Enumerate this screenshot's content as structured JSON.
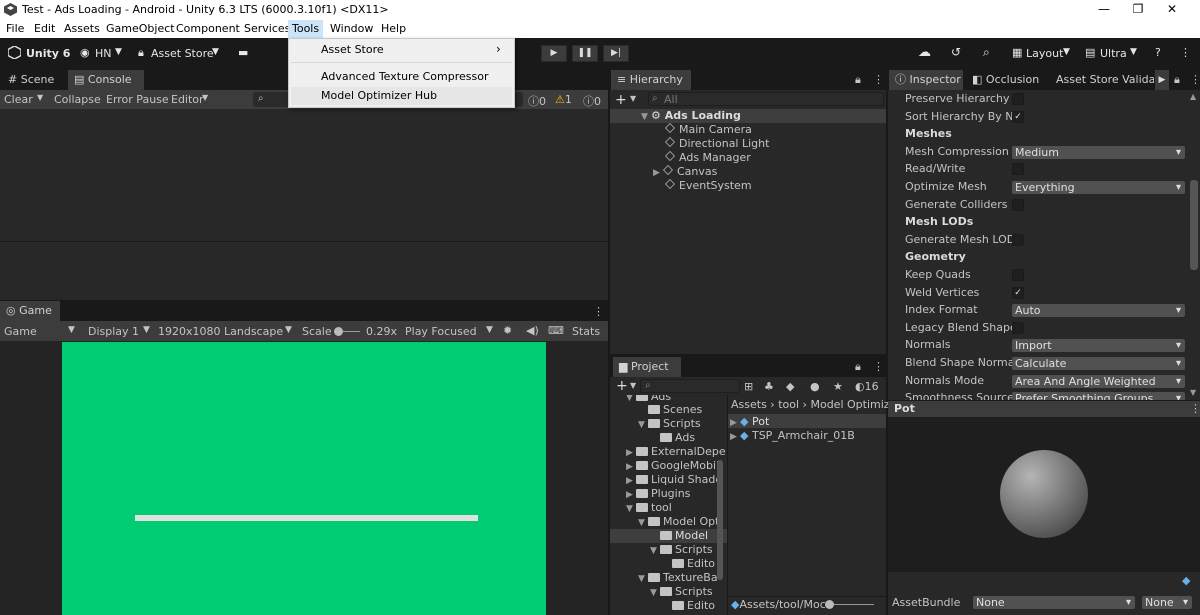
{
  "window": {
    "title": "Test - Ads Loading - Android - Unity 6.3 LTS (6000.3.10f1) <DX11>",
    "min": "—",
    "max": "❐",
    "close": "✕"
  },
  "menubar": [
    "File",
    "Edit",
    "Assets",
    "GameObject",
    "Component",
    "Services",
    "Tools",
    "Window",
    "Help"
  ],
  "toolbar": {
    "unity": "Unity 6",
    "account": "HN",
    "asset_store": "Asset Store",
    "layout": "Layout",
    "quality": "Ultra"
  },
  "tools_menu": {
    "items": [
      "Asset Store",
      "Advanced Texture Compressor",
      "Model Optimizer Hub"
    ],
    "submenu_arrow": "›"
  },
  "scene_tabs": {
    "scene": "Scene",
    "console": "Console"
  },
  "console": {
    "clear": "Clear",
    "collapse": "Collapse",
    "error_pause": "Error Pause",
    "editor": "Editor",
    "log_count": "0",
    "warn_count": "1",
    "error_count": "0"
  },
  "game": {
    "tab": "Game",
    "mode": "Game",
    "display": "Display 1",
    "resolution": "1920x1080 Landscape",
    "scale_label": "Scale",
    "scale_value": "0.29x",
    "play_focused": "Play Focused",
    "stats": "Stats",
    "bg_color": "#00cc74",
    "progress": 1.0
  },
  "hierarchy": {
    "tab": "Hierarchy",
    "search": "All",
    "scene": "Ads Loading",
    "items": [
      "Main Camera",
      "Directional Light",
      "Ads Manager",
      "Canvas",
      "EventSystem"
    ]
  },
  "project": {
    "tab": "Project",
    "count": "16",
    "tree": [
      "Ads",
      "Scenes",
      "Scripts",
      "Ads",
      "ExternalDepe",
      "GoogleMobil",
      "Liquid Shade",
      "Plugins",
      "tool",
      "Model Opt",
      "Model",
      "Scripts",
      "Edito",
      "TextureBa",
      "Scripts",
      "Edito"
    ],
    "breadcrumb": [
      "Assets",
      "tool",
      "Model Optimiz"
    ],
    "files": [
      "Pot",
      "TSP_Armchair_01B"
    ],
    "path": "Assets/tool/Moc"
  },
  "inspector": {
    "tabs": [
      "Inspector",
      "Occlusion",
      "Asset Store Validato"
    ],
    "rows": [
      {
        "label": "Preserve Hierarchy",
        "type": "check",
        "value": ""
      },
      {
        "label": "Sort Hierarchy By Nar",
        "type": "check",
        "value": "✓"
      },
      {
        "label": "Meshes",
        "type": "header"
      },
      {
        "label": "Mesh Compression",
        "type": "drop",
        "value": "Medium"
      },
      {
        "label": "Read/Write",
        "type": "check",
        "value": ""
      },
      {
        "label": "Optimize Mesh",
        "type": "drop",
        "value": "Everything"
      },
      {
        "label": "Generate Colliders",
        "type": "check",
        "value": ""
      },
      {
        "label": "Mesh LODs",
        "type": "header"
      },
      {
        "label": "Generate Mesh LODs",
        "type": "check",
        "value": ""
      },
      {
        "label": "Geometry",
        "type": "header"
      },
      {
        "label": "Keep Quads",
        "type": "check",
        "value": ""
      },
      {
        "label": "Weld Vertices",
        "type": "check",
        "value": "✓"
      },
      {
        "label": "Index Format",
        "type": "drop",
        "value": "Auto"
      },
      {
        "label": "Legacy Blend Shape",
        "type": "check",
        "value": ""
      },
      {
        "label": "Normals",
        "type": "drop",
        "value": "Import"
      },
      {
        "label": "Blend Shape Normals",
        "type": "drop",
        "value": "Calculate"
      },
      {
        "label": "Normals Mode",
        "type": "drop",
        "value": "Area And Angle Weighted"
      },
      {
        "label": "Smoothness Source",
        "type": "drop",
        "value": "Prefer Smoothing Groups"
      }
    ],
    "preview_title": "Pot",
    "assetbundle_label": "AssetBundle",
    "assetbundle_value": "None",
    "variant_value": "None"
  }
}
